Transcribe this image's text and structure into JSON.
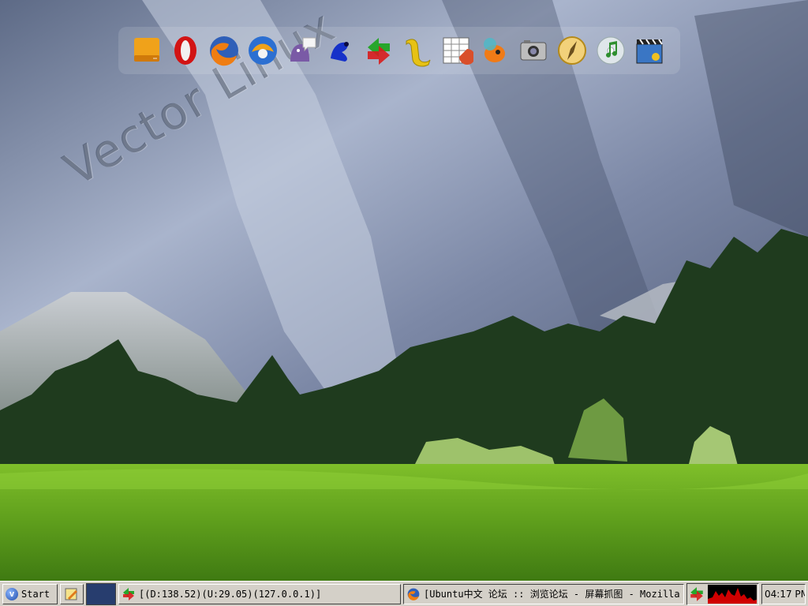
{
  "wallpaper": {
    "watermark": "Vector Linux",
    "colors": {
      "sky_rock": "#7f8fb0",
      "forest": "#1f3b1e",
      "meadow": "#5f9e1c"
    }
  },
  "dock": {
    "icons": [
      {
        "name": "drive-icon"
      },
      {
        "name": "opera-icon"
      },
      {
        "name": "firefox-icon"
      },
      {
        "name": "thunderbird-icon"
      },
      {
        "name": "pidgin-icon"
      },
      {
        "name": "frog-icon"
      },
      {
        "name": "network-arrows-icon"
      },
      {
        "name": "writer-icon"
      },
      {
        "name": "spreadsheet-icon"
      },
      {
        "name": "fish-game-icon"
      },
      {
        "name": "camera-icon"
      },
      {
        "name": "compass-icon"
      },
      {
        "name": "music-cd-icon"
      },
      {
        "name": "movie-icon"
      }
    ]
  },
  "taskbar": {
    "start_label": "Start",
    "task1_label": "[(D:138.52)(U:29.05)(127.0.0.1)]",
    "task2_label": "[Ubuntu中文 论坛 :: 浏览论坛 - 屏幕抓图 - Mozilla",
    "clock": "04:17 PM",
    "colors": {
      "bar": "#d4d0c8",
      "pager": "#273d6e",
      "cpu_graph": "#d00000"
    }
  }
}
